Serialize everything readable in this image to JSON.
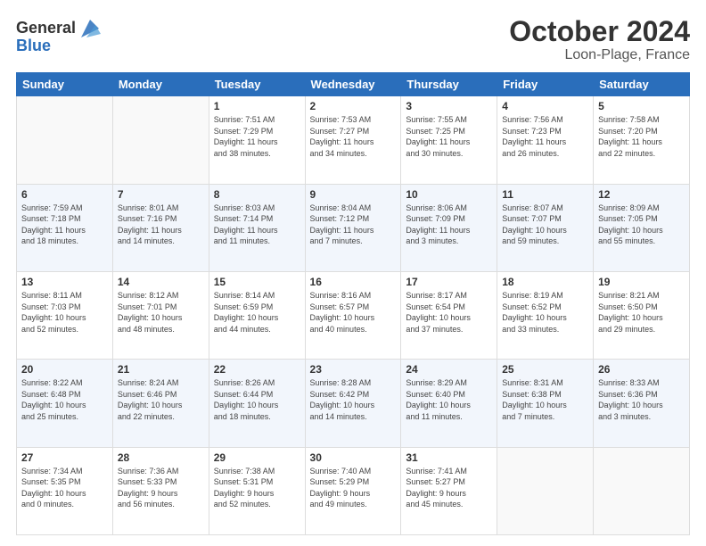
{
  "header": {
    "logo_general": "General",
    "logo_blue": "Blue",
    "month": "October 2024",
    "location": "Loon-Plage, France"
  },
  "weekdays": [
    "Sunday",
    "Monday",
    "Tuesday",
    "Wednesday",
    "Thursday",
    "Friday",
    "Saturday"
  ],
  "weeks": [
    [
      {
        "day": "",
        "info": ""
      },
      {
        "day": "",
        "info": ""
      },
      {
        "day": "1",
        "info": "Sunrise: 7:51 AM\nSunset: 7:29 PM\nDaylight: 11 hours\nand 38 minutes."
      },
      {
        "day": "2",
        "info": "Sunrise: 7:53 AM\nSunset: 7:27 PM\nDaylight: 11 hours\nand 34 minutes."
      },
      {
        "day": "3",
        "info": "Sunrise: 7:55 AM\nSunset: 7:25 PM\nDaylight: 11 hours\nand 30 minutes."
      },
      {
        "day": "4",
        "info": "Sunrise: 7:56 AM\nSunset: 7:23 PM\nDaylight: 11 hours\nand 26 minutes."
      },
      {
        "day": "5",
        "info": "Sunrise: 7:58 AM\nSunset: 7:20 PM\nDaylight: 11 hours\nand 22 minutes."
      }
    ],
    [
      {
        "day": "6",
        "info": "Sunrise: 7:59 AM\nSunset: 7:18 PM\nDaylight: 11 hours\nand 18 minutes."
      },
      {
        "day": "7",
        "info": "Sunrise: 8:01 AM\nSunset: 7:16 PM\nDaylight: 11 hours\nand 14 minutes."
      },
      {
        "day": "8",
        "info": "Sunrise: 8:03 AM\nSunset: 7:14 PM\nDaylight: 11 hours\nand 11 minutes."
      },
      {
        "day": "9",
        "info": "Sunrise: 8:04 AM\nSunset: 7:12 PM\nDaylight: 11 hours\nand 7 minutes."
      },
      {
        "day": "10",
        "info": "Sunrise: 8:06 AM\nSunset: 7:09 PM\nDaylight: 11 hours\nand 3 minutes."
      },
      {
        "day": "11",
        "info": "Sunrise: 8:07 AM\nSunset: 7:07 PM\nDaylight: 10 hours\nand 59 minutes."
      },
      {
        "day": "12",
        "info": "Sunrise: 8:09 AM\nSunset: 7:05 PM\nDaylight: 10 hours\nand 55 minutes."
      }
    ],
    [
      {
        "day": "13",
        "info": "Sunrise: 8:11 AM\nSunset: 7:03 PM\nDaylight: 10 hours\nand 52 minutes."
      },
      {
        "day": "14",
        "info": "Sunrise: 8:12 AM\nSunset: 7:01 PM\nDaylight: 10 hours\nand 48 minutes."
      },
      {
        "day": "15",
        "info": "Sunrise: 8:14 AM\nSunset: 6:59 PM\nDaylight: 10 hours\nand 44 minutes."
      },
      {
        "day": "16",
        "info": "Sunrise: 8:16 AM\nSunset: 6:57 PM\nDaylight: 10 hours\nand 40 minutes."
      },
      {
        "day": "17",
        "info": "Sunrise: 8:17 AM\nSunset: 6:54 PM\nDaylight: 10 hours\nand 37 minutes."
      },
      {
        "day": "18",
        "info": "Sunrise: 8:19 AM\nSunset: 6:52 PM\nDaylight: 10 hours\nand 33 minutes."
      },
      {
        "day": "19",
        "info": "Sunrise: 8:21 AM\nSunset: 6:50 PM\nDaylight: 10 hours\nand 29 minutes."
      }
    ],
    [
      {
        "day": "20",
        "info": "Sunrise: 8:22 AM\nSunset: 6:48 PM\nDaylight: 10 hours\nand 25 minutes."
      },
      {
        "day": "21",
        "info": "Sunrise: 8:24 AM\nSunset: 6:46 PM\nDaylight: 10 hours\nand 22 minutes."
      },
      {
        "day": "22",
        "info": "Sunrise: 8:26 AM\nSunset: 6:44 PM\nDaylight: 10 hours\nand 18 minutes."
      },
      {
        "day": "23",
        "info": "Sunrise: 8:28 AM\nSunset: 6:42 PM\nDaylight: 10 hours\nand 14 minutes."
      },
      {
        "day": "24",
        "info": "Sunrise: 8:29 AM\nSunset: 6:40 PM\nDaylight: 10 hours\nand 11 minutes."
      },
      {
        "day": "25",
        "info": "Sunrise: 8:31 AM\nSunset: 6:38 PM\nDaylight: 10 hours\nand 7 minutes."
      },
      {
        "day": "26",
        "info": "Sunrise: 8:33 AM\nSunset: 6:36 PM\nDaylight: 10 hours\nand 3 minutes."
      }
    ],
    [
      {
        "day": "27",
        "info": "Sunrise: 7:34 AM\nSunset: 5:35 PM\nDaylight: 10 hours\nand 0 minutes."
      },
      {
        "day": "28",
        "info": "Sunrise: 7:36 AM\nSunset: 5:33 PM\nDaylight: 9 hours\nand 56 minutes."
      },
      {
        "day": "29",
        "info": "Sunrise: 7:38 AM\nSunset: 5:31 PM\nDaylight: 9 hours\nand 52 minutes."
      },
      {
        "day": "30",
        "info": "Sunrise: 7:40 AM\nSunset: 5:29 PM\nDaylight: 9 hours\nand 49 minutes."
      },
      {
        "day": "31",
        "info": "Sunrise: 7:41 AM\nSunset: 5:27 PM\nDaylight: 9 hours\nand 45 minutes."
      },
      {
        "day": "",
        "info": ""
      },
      {
        "day": "",
        "info": ""
      }
    ]
  ]
}
